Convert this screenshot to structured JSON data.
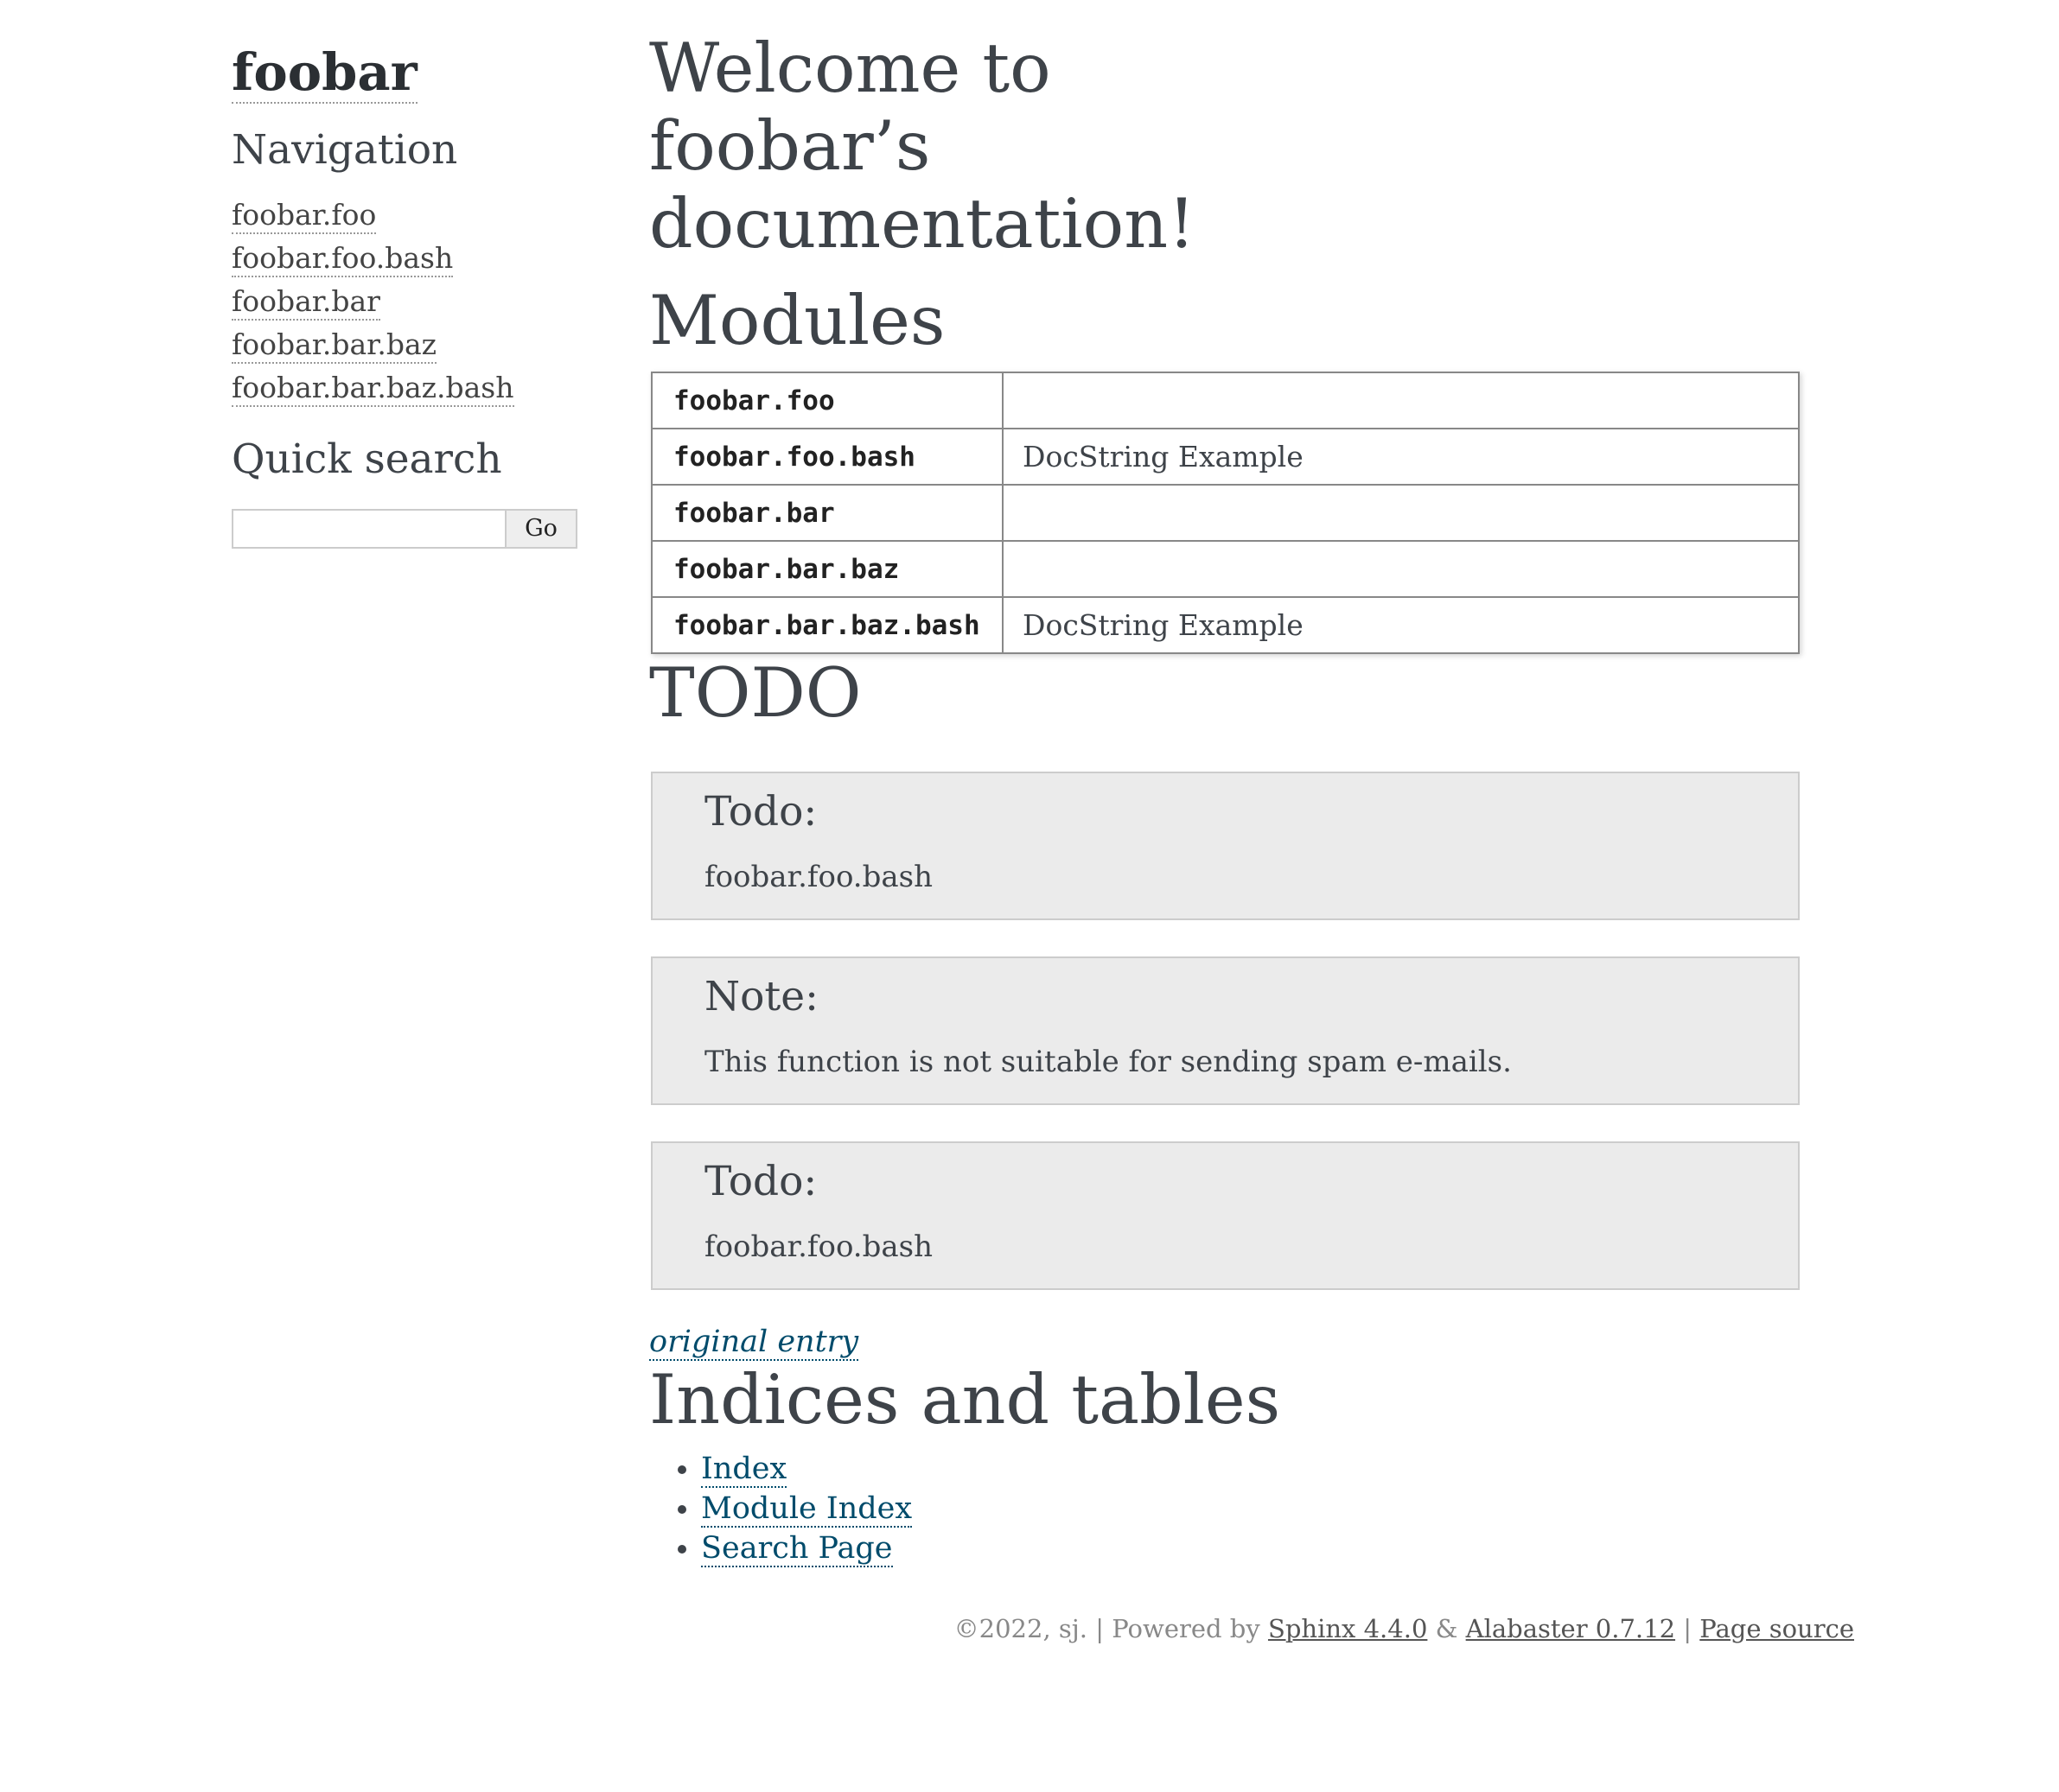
{
  "sidebar": {
    "logo": "foobar",
    "navigation_heading": "Navigation",
    "nav_items": [
      {
        "label": "foobar.foo"
      },
      {
        "label": "foobar.foo.bash"
      },
      {
        "label": "foobar.bar"
      },
      {
        "label": "foobar.bar.baz"
      },
      {
        "label": "foobar.bar.baz.bash"
      }
    ],
    "search_heading": "Quick search",
    "search_value": "",
    "search_button": "Go"
  },
  "main": {
    "title": "Welcome to foobar’s documentation!",
    "modules_heading": "Modules",
    "modules": [
      {
        "name": "foobar.foo",
        "desc": ""
      },
      {
        "name": "foobar.foo.bash",
        "desc": "DocString Example"
      },
      {
        "name": "foobar.bar",
        "desc": ""
      },
      {
        "name": "foobar.bar.baz",
        "desc": ""
      },
      {
        "name": "foobar.bar.baz.bash",
        "desc": "DocString Example"
      }
    ],
    "todo_heading": "TODO",
    "admonitions": [
      {
        "title": "Todo:",
        "body": "foobar.foo.bash"
      },
      {
        "title": "Note:",
        "body": "This function is not suitable for sending spam e-mails."
      },
      {
        "title": "Todo:",
        "body": "foobar.foo.bash"
      }
    ],
    "original_entry": "original entry",
    "indices_heading": "Indices and tables",
    "indices": [
      {
        "label": "Index"
      },
      {
        "label": "Module Index"
      },
      {
        "label": "Search Page"
      }
    ]
  },
  "footer": {
    "copyright": "©2022, sj.",
    "sep1": " | Powered by ",
    "sphinx": "Sphinx 4.4.0",
    "amp": " & ",
    "alabaster": "Alabaster 0.7.12",
    "sep2": " | ",
    "page_source": "Page source"
  },
  "colors": {
    "text": "#3e4349",
    "link": "#004b6b",
    "admonition_bg": "#ebebeb",
    "footer_text": "#888888"
  }
}
